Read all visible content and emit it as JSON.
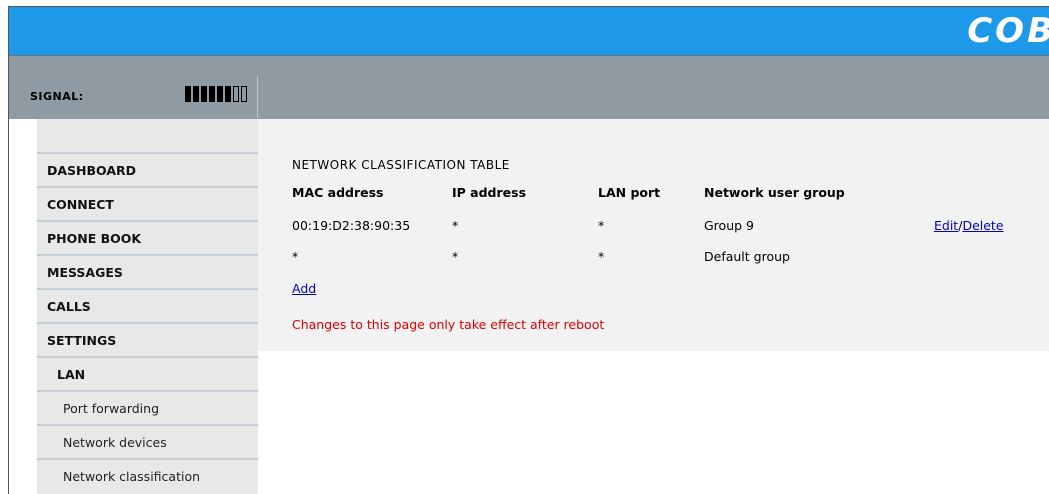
{
  "header": {
    "brand": "COB"
  },
  "signal": {
    "label": "SIGNAL:",
    "bars_filled": 6,
    "bars_total": 8
  },
  "sidebar": {
    "items": [
      {
        "label": "DASHBOARD"
      },
      {
        "label": "CONNECT"
      },
      {
        "label": "PHONE BOOK"
      },
      {
        "label": "MESSAGES"
      },
      {
        "label": "CALLS"
      },
      {
        "label": "SETTINGS"
      },
      {
        "label": "LAN"
      },
      {
        "label": "Port forwarding"
      },
      {
        "label": "Network devices"
      },
      {
        "label": "Network classification"
      }
    ]
  },
  "main": {
    "title": "NETWORK CLASSIFICATION TABLE",
    "columns": [
      "MAC address",
      "IP address",
      "LAN port",
      "Network user group"
    ],
    "rows": [
      {
        "mac": "00:19:D2:38:90:35",
        "ip": "*",
        "port": "*",
        "group": "Group 9",
        "edit": "Edit",
        "sep": "/",
        "delete": "Delete"
      },
      {
        "mac": "*",
        "ip": "*",
        "port": "*",
        "group": "Default group"
      }
    ],
    "add_label": "Add",
    "notice": "Changes to this page only take effect after reboot"
  },
  "colors": {
    "topbar": "#1e98e8",
    "signalbar": "#909aa2",
    "sidebar_bg": "#e8e8e8",
    "content_bg": "#f2f2f2",
    "link": "#0000cc",
    "notice": "#e00000"
  }
}
